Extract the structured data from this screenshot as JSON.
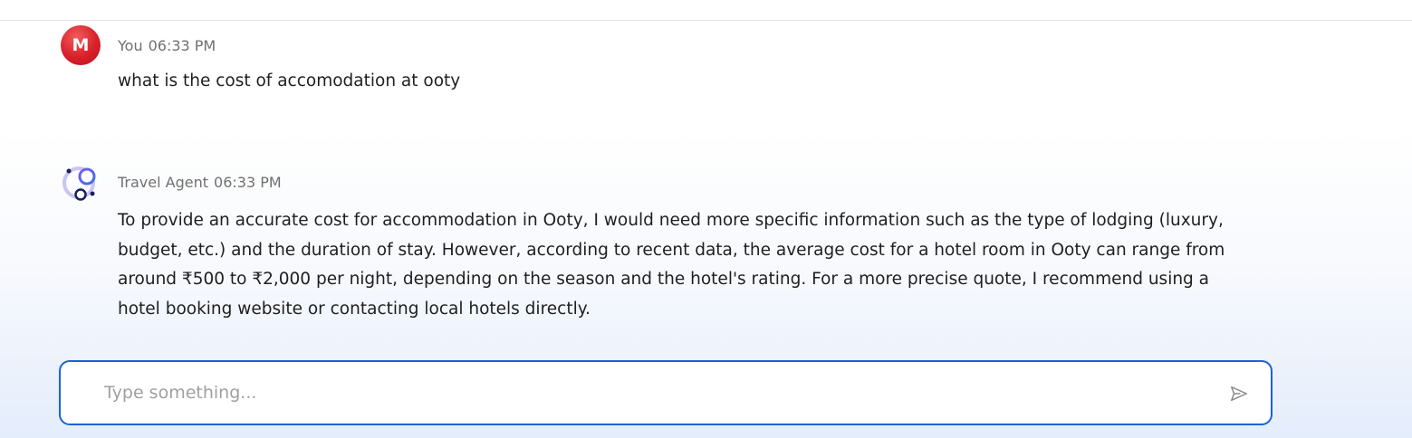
{
  "messages": [
    {
      "avatar_letter": "M",
      "sender": "You",
      "time": "06:33 PM",
      "text": "what is the cost of accomodation at ooty"
    },
    {
      "sender": "Travel Agent",
      "time": "06:33 PM",
      "text": "To provide an accurate cost for accommodation in Ooty, I would need more specific information such as the type of lodging (luxury, budget, etc.) and the duration of stay. However, according to recent data, the average cost for a hotel room in Ooty can range from around ₹500 to ₹2,000 per night, depending on the season and the hotel's rating. For a more precise quote, I recommend using a hotel booking website or contacting local hotels directly."
    }
  ],
  "composer": {
    "placeholder": "Type something...",
    "value": ""
  },
  "icons": {
    "agent_avatar": "bubbles-logo-icon",
    "send": "send-icon"
  },
  "colors": {
    "accent": "#1a63d8",
    "user_avatar": "#d8202a"
  }
}
